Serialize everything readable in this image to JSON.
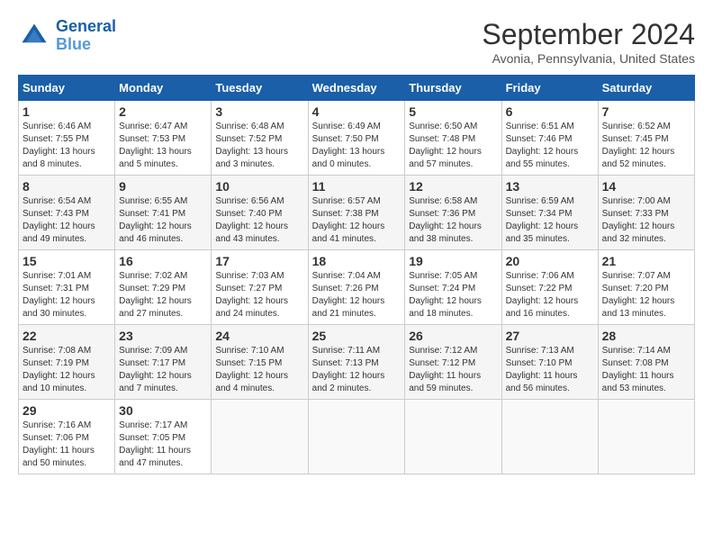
{
  "header": {
    "logo_line1": "General",
    "logo_line2": "Blue",
    "title": "September 2024",
    "subtitle": "Avonia, Pennsylvania, United States"
  },
  "columns": [
    "Sunday",
    "Monday",
    "Tuesday",
    "Wednesday",
    "Thursday",
    "Friday",
    "Saturday"
  ],
  "weeks": [
    [
      {
        "day": "1",
        "sunrise": "6:46 AM",
        "sunset": "7:55 PM",
        "daylight": "13 hours and 8 minutes."
      },
      {
        "day": "2",
        "sunrise": "6:47 AM",
        "sunset": "7:53 PM",
        "daylight": "13 hours and 5 minutes."
      },
      {
        "day": "3",
        "sunrise": "6:48 AM",
        "sunset": "7:52 PM",
        "daylight": "13 hours and 3 minutes."
      },
      {
        "day": "4",
        "sunrise": "6:49 AM",
        "sunset": "7:50 PM",
        "daylight": "13 hours and 0 minutes."
      },
      {
        "day": "5",
        "sunrise": "6:50 AM",
        "sunset": "7:48 PM",
        "daylight": "12 hours and 57 minutes."
      },
      {
        "day": "6",
        "sunrise": "6:51 AM",
        "sunset": "7:46 PM",
        "daylight": "12 hours and 55 minutes."
      },
      {
        "day": "7",
        "sunrise": "6:52 AM",
        "sunset": "7:45 PM",
        "daylight": "12 hours and 52 minutes."
      }
    ],
    [
      {
        "day": "8",
        "sunrise": "6:54 AM",
        "sunset": "7:43 PM",
        "daylight": "12 hours and 49 minutes."
      },
      {
        "day": "9",
        "sunrise": "6:55 AM",
        "sunset": "7:41 PM",
        "daylight": "12 hours and 46 minutes."
      },
      {
        "day": "10",
        "sunrise": "6:56 AM",
        "sunset": "7:40 PM",
        "daylight": "12 hours and 43 minutes."
      },
      {
        "day": "11",
        "sunrise": "6:57 AM",
        "sunset": "7:38 PM",
        "daylight": "12 hours and 41 minutes."
      },
      {
        "day": "12",
        "sunrise": "6:58 AM",
        "sunset": "7:36 PM",
        "daylight": "12 hours and 38 minutes."
      },
      {
        "day": "13",
        "sunrise": "6:59 AM",
        "sunset": "7:34 PM",
        "daylight": "12 hours and 35 minutes."
      },
      {
        "day": "14",
        "sunrise": "7:00 AM",
        "sunset": "7:33 PM",
        "daylight": "12 hours and 32 minutes."
      }
    ],
    [
      {
        "day": "15",
        "sunrise": "7:01 AM",
        "sunset": "7:31 PM",
        "daylight": "12 hours and 30 minutes."
      },
      {
        "day": "16",
        "sunrise": "7:02 AM",
        "sunset": "7:29 PM",
        "daylight": "12 hours and 27 minutes."
      },
      {
        "day": "17",
        "sunrise": "7:03 AM",
        "sunset": "7:27 PM",
        "daylight": "12 hours and 24 minutes."
      },
      {
        "day": "18",
        "sunrise": "7:04 AM",
        "sunset": "7:26 PM",
        "daylight": "12 hours and 21 minutes."
      },
      {
        "day": "19",
        "sunrise": "7:05 AM",
        "sunset": "7:24 PM",
        "daylight": "12 hours and 18 minutes."
      },
      {
        "day": "20",
        "sunrise": "7:06 AM",
        "sunset": "7:22 PM",
        "daylight": "12 hours and 16 minutes."
      },
      {
        "day": "21",
        "sunrise": "7:07 AM",
        "sunset": "7:20 PM",
        "daylight": "12 hours and 13 minutes."
      }
    ],
    [
      {
        "day": "22",
        "sunrise": "7:08 AM",
        "sunset": "7:19 PM",
        "daylight": "12 hours and 10 minutes."
      },
      {
        "day": "23",
        "sunrise": "7:09 AM",
        "sunset": "7:17 PM",
        "daylight": "12 hours and 7 minutes."
      },
      {
        "day": "24",
        "sunrise": "7:10 AM",
        "sunset": "7:15 PM",
        "daylight": "12 hours and 4 minutes."
      },
      {
        "day": "25",
        "sunrise": "7:11 AM",
        "sunset": "7:13 PM",
        "daylight": "12 hours and 2 minutes."
      },
      {
        "day": "26",
        "sunrise": "7:12 AM",
        "sunset": "7:12 PM",
        "daylight": "11 hours and 59 minutes."
      },
      {
        "day": "27",
        "sunrise": "7:13 AM",
        "sunset": "7:10 PM",
        "daylight": "11 hours and 56 minutes."
      },
      {
        "day": "28",
        "sunrise": "7:14 AM",
        "sunset": "7:08 PM",
        "daylight": "11 hours and 53 minutes."
      }
    ],
    [
      {
        "day": "29",
        "sunrise": "7:16 AM",
        "sunset": "7:06 PM",
        "daylight": "11 hours and 50 minutes."
      },
      {
        "day": "30",
        "sunrise": "7:17 AM",
        "sunset": "7:05 PM",
        "daylight": "11 hours and 47 minutes."
      },
      null,
      null,
      null,
      null,
      null
    ]
  ]
}
